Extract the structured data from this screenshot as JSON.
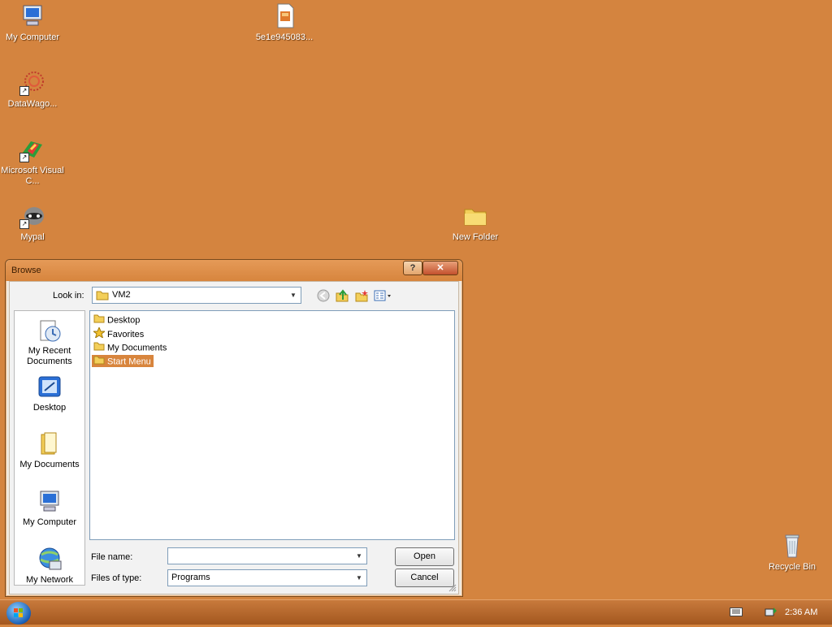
{
  "desktop": {
    "icons": [
      {
        "label": "My Computer",
        "icon": "computer-icon"
      },
      {
        "label": "5e1e945083...",
        "icon": "file-icon"
      },
      {
        "label": "DataWago...",
        "icon": "datawagon-icon"
      },
      {
        "label": "Microsoft Visual C...",
        "icon": "visual-c-icon"
      },
      {
        "label": "Mypal",
        "icon": "mypal-icon"
      },
      {
        "label": "New Folder",
        "icon": "folder-icon"
      },
      {
        "label": "Recycle Bin",
        "icon": "recycle-bin-icon"
      }
    ]
  },
  "dialog": {
    "title": "Browse",
    "help_label": "?",
    "close_label": "✕",
    "look_in_label": "Look in:",
    "look_in_value": "VM2",
    "places": [
      {
        "label": "My Recent Documents",
        "icon": "recent-documents-icon"
      },
      {
        "label": "Desktop",
        "icon": "desktop-icon"
      },
      {
        "label": "My Documents",
        "icon": "my-documents-icon"
      },
      {
        "label": "My Computer",
        "icon": "computer-icon"
      },
      {
        "label": "My Network",
        "icon": "network-icon"
      }
    ],
    "files": [
      {
        "name": "Desktop",
        "icon": "folder-icon",
        "selected": false
      },
      {
        "name": "Favorites",
        "icon": "favorites-star-icon",
        "selected": false
      },
      {
        "name": "My Documents",
        "icon": "folder-icon",
        "selected": false
      },
      {
        "name": "Start Menu",
        "icon": "folder-icon",
        "selected": true
      }
    ],
    "file_name_label": "File name:",
    "file_name_value": "",
    "files_of_type_label": "Files of type:",
    "files_of_type_value": "Programs",
    "open_label": "Open",
    "cancel_label": "Cancel"
  },
  "taskbar": {
    "clock": "2:36 AM"
  },
  "colors": {
    "desktop": "#d4843f",
    "selection": "#d8853d"
  }
}
